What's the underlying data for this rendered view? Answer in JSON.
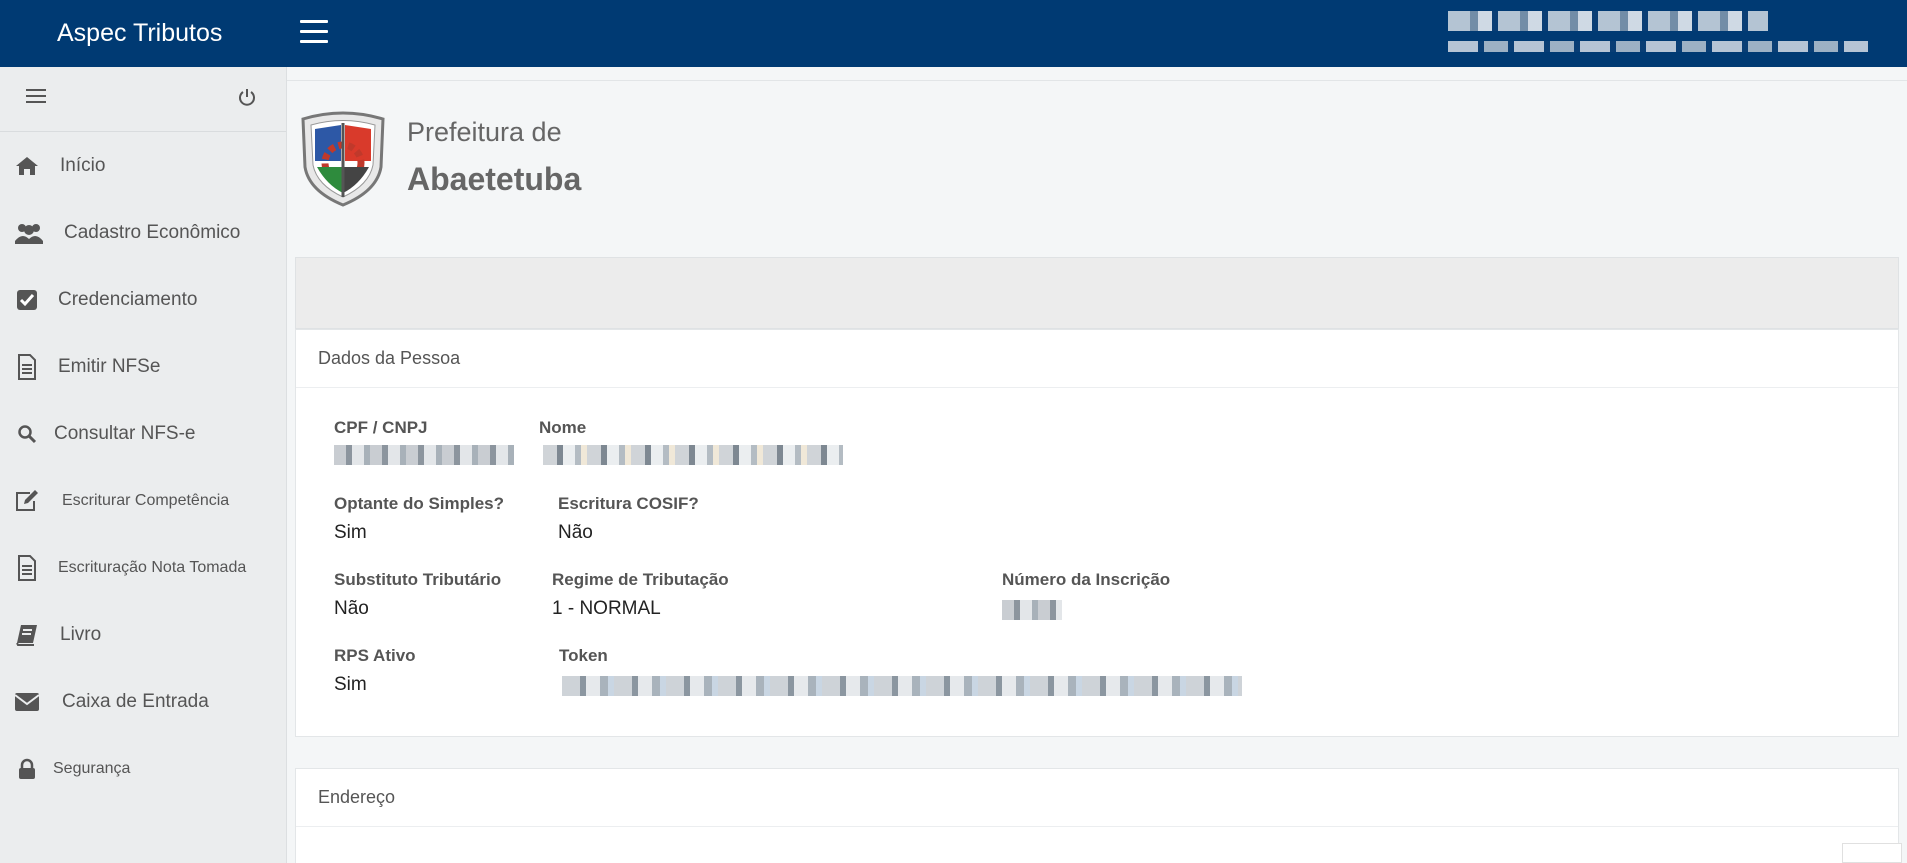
{
  "app": {
    "title": "Aspec Tributos"
  },
  "sidebar": {
    "items": [
      {
        "label": "Início",
        "icon": "home-icon"
      },
      {
        "label": "Cadastro Econômico",
        "icon": "users-icon"
      },
      {
        "label": "Credenciamento",
        "icon": "check-square-icon"
      },
      {
        "label": "Emitir NFSe",
        "icon": "document-icon"
      },
      {
        "label": "Consultar NFS-e",
        "icon": "search-icon"
      },
      {
        "label": "Escriturar Competência",
        "icon": "edit-icon"
      },
      {
        "label": "Escrituração Nota Tomada",
        "icon": "document-icon"
      },
      {
        "label": "Livro",
        "icon": "book-icon"
      },
      {
        "label": "Caixa de Entrada",
        "icon": "envelope-icon"
      },
      {
        "label": "Segurança",
        "icon": "lock-icon"
      }
    ]
  },
  "header": {
    "prefeitura_line1": "Prefeitura de",
    "prefeitura_line2": "Abaetetuba"
  },
  "person": {
    "section_title": "Dados da Pessoa",
    "cpf_cnpj_label": "CPF / CNPJ",
    "nome_label": "Nome",
    "optante_label": "Optante do Simples?",
    "optante_value": "Sim",
    "cosif_label": "Escritura COSIF?",
    "cosif_value": "Não",
    "substituto_label": "Substituto Tributário",
    "substituto_value": "Não",
    "regime_label": "Regime de Tributação",
    "regime_value": "1 - NORMAL",
    "inscricao_label": "Número da Inscrição",
    "rps_label": "RPS Ativo",
    "rps_value": "Sim",
    "token_label": "Token"
  },
  "address": {
    "section_title": "Endereço"
  },
  "colors": {
    "topbar": "#003a73",
    "sidebar": "#ebedee",
    "text": "#555555"
  }
}
